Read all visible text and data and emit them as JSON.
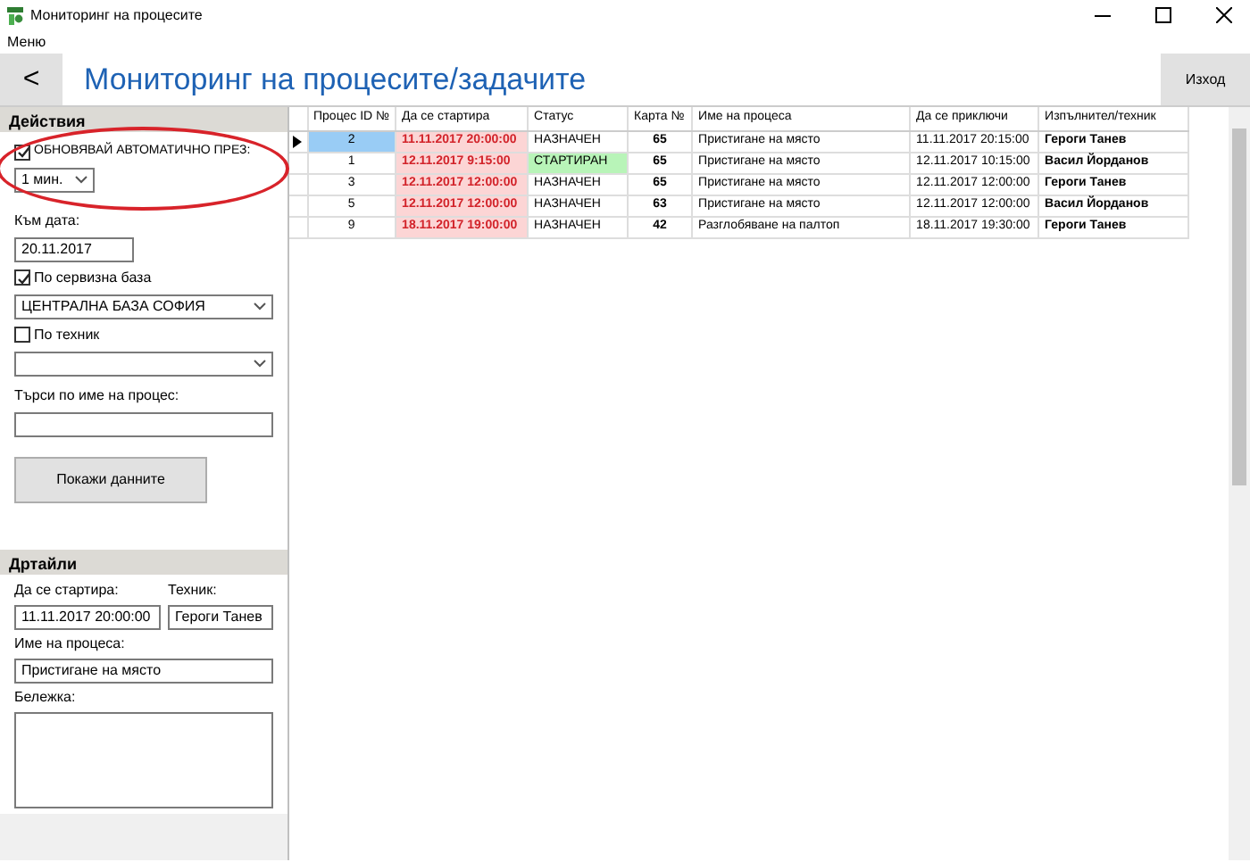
{
  "window": {
    "title": "Мониторинг на процесите"
  },
  "menu": [
    "Меню"
  ],
  "header": {
    "back": "<",
    "title": "Мониторинг на процесите/задачите",
    "exit": "Изход"
  },
  "actions": {
    "title": "Действия",
    "auto_refresh": {
      "label": "ОБНОВЯВАЙ АВТОМАТИЧНО ПРЕЗ:",
      "checked": true,
      "interval": "1 мин."
    },
    "date_label": "Към дата:",
    "date": "20.11.2017",
    "base": {
      "label": "По сервизна база",
      "checked": true,
      "value": "ЦЕНТРАЛНА БАЗА СОФИЯ"
    },
    "technician": {
      "label": "По техник",
      "checked": false
    },
    "search_label": "Търси по име на процес:",
    "show_button": "Покажи данните"
  },
  "details": {
    "title": "Дртайли",
    "start_label": "Да се стартира:",
    "start": "11.11.2017 20:00:00",
    "tech_label": "Техник:",
    "tech": "Героги Танев",
    "name_label": "Име на процеса:",
    "name": "Пристигане на място",
    "note_label": "Бележка:"
  },
  "table": {
    "columns": [
      "Процес ID №",
      "Да се стартира",
      "Статус",
      "Карта №",
      "Име на процеса",
      "Да се приключи",
      "Изпълнител/техник"
    ],
    "rows": [
      {
        "selected": true,
        "kind": "assigned",
        "cells": [
          "2",
          "11.11.2017 20:00:00",
          "НАЗНАЧЕН",
          "65",
          "Пристигане на място",
          "11.11.2017 20:15:00",
          "Героги Танев"
        ]
      },
      {
        "selected": false,
        "kind": "started",
        "cells": [
          "1",
          "12.11.2017 9:15:00",
          "СТАРТИРАН",
          "65",
          "Пристигане на място",
          "12.11.2017 10:15:00",
          "Васил Йорданов"
        ]
      },
      {
        "selected": false,
        "kind": "assigned",
        "cells": [
          "3",
          "12.11.2017 12:00:00",
          "НАЗНАЧЕН",
          "65",
          "Пристигане на място",
          "12.11.2017 12:00:00",
          "Героги Танев"
        ]
      },
      {
        "selected": false,
        "kind": "assigned",
        "cells": [
          "5",
          "12.11.2017 12:00:00",
          "НАЗНАЧЕН",
          "63",
          "Пристигане на място",
          "12.11.2017 12:00:00",
          "Васил Йорданов"
        ]
      },
      {
        "selected": false,
        "kind": "assigned",
        "cells": [
          "9",
          "18.11.2017 19:00:00",
          "НАЗНАЧЕН",
          "42",
          "Разглобяване на палтоп",
          "18.11.2017 19:30:00",
          "Героги Танев"
        ]
      }
    ]
  }
}
